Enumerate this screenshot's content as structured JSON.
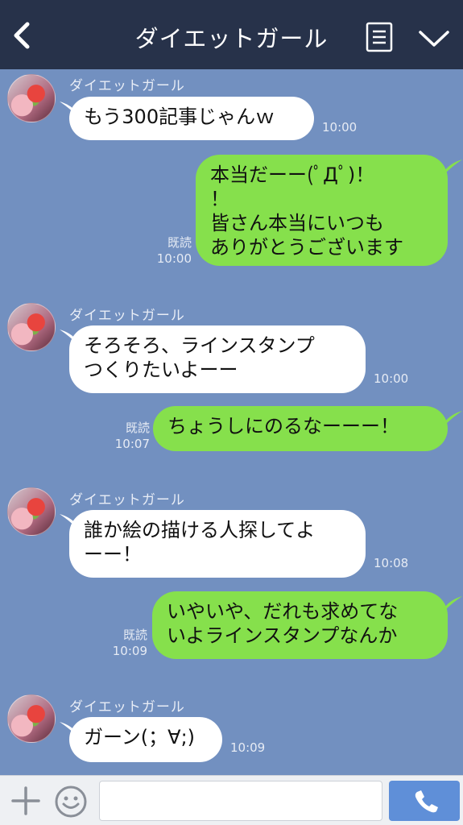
{
  "header": {
    "title": "ダイエットガール"
  },
  "messages": {
    "m1": {
      "sender": "ダイエットガール",
      "text": "もう300記事じゃんｗ",
      "time": "10:00"
    },
    "m2": {
      "text": "本当だーー(ﾟДﾟ)！\n！\n皆さん本当にいつも\nありがとうございます",
      "read": "既読",
      "time": "10:00"
    },
    "m3": {
      "sender": "ダイエットガール",
      "text": "そろそろ、ラインスタンプ\nつくりたいよーー",
      "time": "10:00"
    },
    "m4": {
      "text": "ちょうしにのるなーーー！",
      "read": "既読",
      "time": "10:07"
    },
    "m5": {
      "sender": "ダイエットガール",
      "text": "誰か絵の描ける人探してよ\nーー！",
      "time": "10:08"
    },
    "m6": {
      "text": "いやいや、だれも求めてな\nいよラインスタンプなんか",
      "read": "既読",
      "time": "10:09"
    },
    "m7": {
      "sender": "ダイエットガール",
      "text": "ガーン(；∀;)",
      "time": "10:09"
    }
  },
  "footer": {
    "input_value": ""
  },
  "colors": {
    "background": "#7290c0",
    "header": "#27324a",
    "outgoing_bubble": "#86e04c",
    "incoming_bubble": "#ffffff",
    "call_button": "#5f8fd8"
  },
  "icons": {
    "back": "chevron-left-icon",
    "menu": "document-list-icon",
    "collapse": "chevron-down-icon",
    "attach": "plus-icon",
    "emoji": "smiley-icon",
    "call": "phone-icon"
  }
}
